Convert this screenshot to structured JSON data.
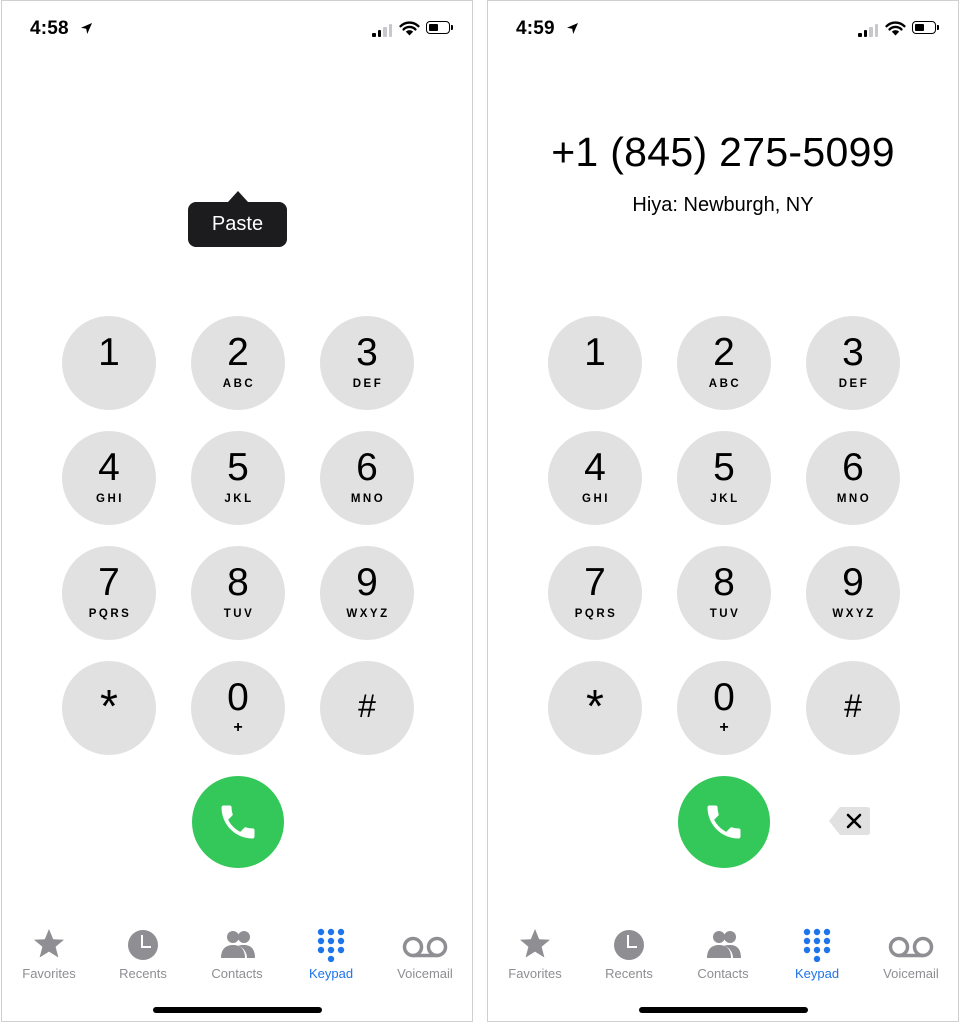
{
  "colors": {
    "key_bg": "#e1e1e1",
    "call_green": "#34c759",
    "tab_inactive": "#8e8e93",
    "tab_active": "#1e74ea",
    "tooltip_bg": "#1c1c1e"
  },
  "left": {
    "status": {
      "time": "4:58"
    },
    "paste_label": "Paste"
  },
  "right": {
    "status": {
      "time": "4:59"
    },
    "dialed_number": "+1 (845) 275-5099",
    "caller_id": "Hiya: Newburgh, NY"
  },
  "keypad": [
    {
      "digit": "1",
      "letters": ""
    },
    {
      "digit": "2",
      "letters": "ABC"
    },
    {
      "digit": "3",
      "letters": "DEF"
    },
    {
      "digit": "4",
      "letters": "GHI"
    },
    {
      "digit": "5",
      "letters": "JKL"
    },
    {
      "digit": "6",
      "letters": "MNO"
    },
    {
      "digit": "7",
      "letters": "PQRS"
    },
    {
      "digit": "8",
      "letters": "TUV"
    },
    {
      "digit": "9",
      "letters": "WXYZ"
    },
    {
      "digit": "*",
      "letters": ""
    },
    {
      "digit": "0",
      "letters": "+"
    },
    {
      "digit": "#",
      "letters": ""
    }
  ],
  "tabs": [
    {
      "label": "Favorites",
      "icon": "star-icon"
    },
    {
      "label": "Recents",
      "icon": "clock-icon"
    },
    {
      "label": "Contacts",
      "icon": "contacts-icon"
    },
    {
      "label": "Keypad",
      "icon": "keypad-icon",
      "active": true
    },
    {
      "label": "Voicemail",
      "icon": "voicemail-icon"
    }
  ]
}
